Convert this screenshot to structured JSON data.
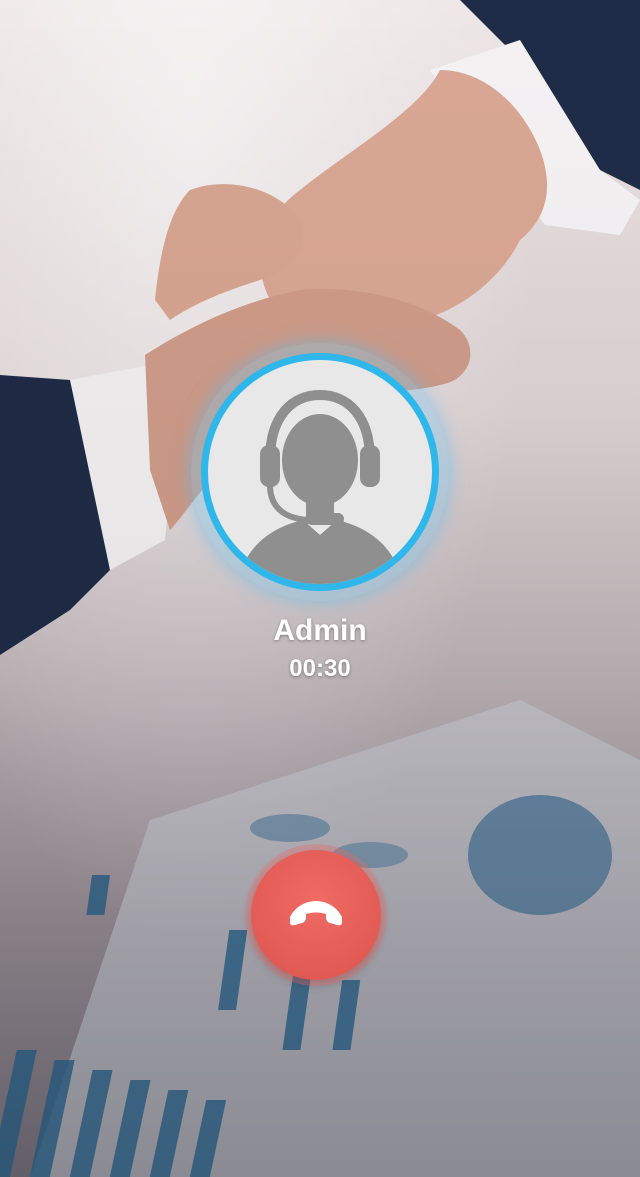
{
  "caller": {
    "name": "Admin",
    "duration": "00:30"
  },
  "controls": {
    "end_call_icon": "phone-hangup-icon",
    "end_call_color": "#e45d56"
  },
  "avatar": {
    "icon": "support-agent-icon",
    "ring_color": "#2fb6ea"
  }
}
